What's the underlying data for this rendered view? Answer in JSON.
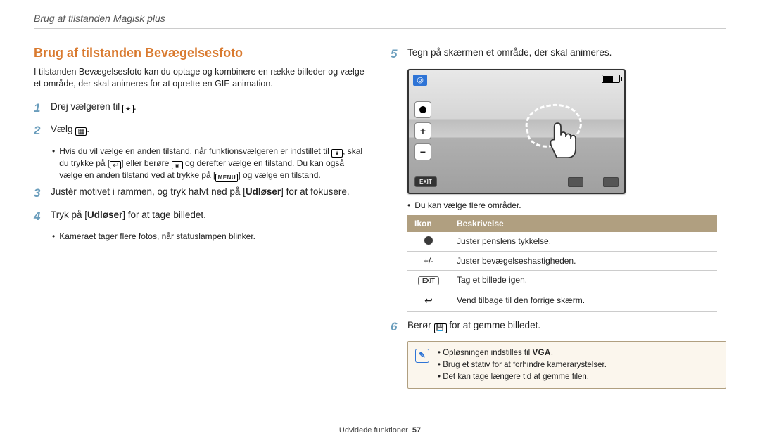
{
  "header": {
    "breadcrumb": "Brug af tilstanden Magisk plus"
  },
  "section": {
    "title": "Brug af tilstanden Bevægelsesfoto",
    "intro": "I tilstanden Bevægelsesfoto kan du optage og kombinere en række billeder og vælge et område, der skal animeres for at oprette en GIF-animation."
  },
  "steps": {
    "s1": {
      "num": "1",
      "pre": "Drej vælgeren til ",
      "post": "."
    },
    "s2": {
      "num": "2",
      "pre": "Vælg ",
      "post": ".",
      "note_a": "Hvis du vil vælge en anden tilstand, når funktionsvælgeren er indstillet til ",
      "note_b": ", skal du trykke på [",
      "note_c": "] eller berøre ",
      "note_d": " og derefter vælge en tilstand. Du kan også vælge en anden tilstand ved at trykke på [",
      "note_e": "] og vælge en tilstand.",
      "menu_label": "MENU"
    },
    "s3": {
      "num": "3",
      "text_a": "Justér motivet i rammen, og tryk halvt ned på [",
      "bold": "Udløser",
      "text_b": "] for at fokusere."
    },
    "s4": {
      "num": "4",
      "text_a": "Tryk på [",
      "bold": "Udløser",
      "text_b": "] for at tage billedet.",
      "sub": "Kameraet tager flere fotos, når statuslampen blinker."
    },
    "s5": {
      "num": "5",
      "text": "Tegn på skærmen et område, der skal animeres.",
      "sub": "Du kan vælge flere områder."
    },
    "s6": {
      "num": "6",
      "text_a": "Berør ",
      "text_b": " for at gemme billedet."
    }
  },
  "preview": {
    "exit": "EXIT",
    "plus": "+",
    "minus": "−"
  },
  "table": {
    "h_icon": "Ikon",
    "h_desc": "Beskrivelse",
    "rows": [
      {
        "icon_key": "dot",
        "desc": "Juster penslens tykkelse."
      },
      {
        "icon_key": "pm",
        "icon_text": "+/-",
        "desc": "Juster bevægelseshastigheden."
      },
      {
        "icon_key": "exit",
        "icon_text": "EXIT",
        "desc": "Tag et billede igen."
      },
      {
        "icon_key": "back",
        "icon_text": "↩",
        "desc": "Vend tilbage til den forrige skærm."
      }
    ]
  },
  "notes": {
    "n1_a": "Opløsningen indstilles til ",
    "n1_vga": "VGA",
    "n1_b": ".",
    "n2": "Brug et stativ for at forhindre kamerarystelser.",
    "n3": "Det kan tage længere tid at gemme filen."
  },
  "footer": {
    "label": "Udvidede funktioner",
    "page": "57"
  }
}
